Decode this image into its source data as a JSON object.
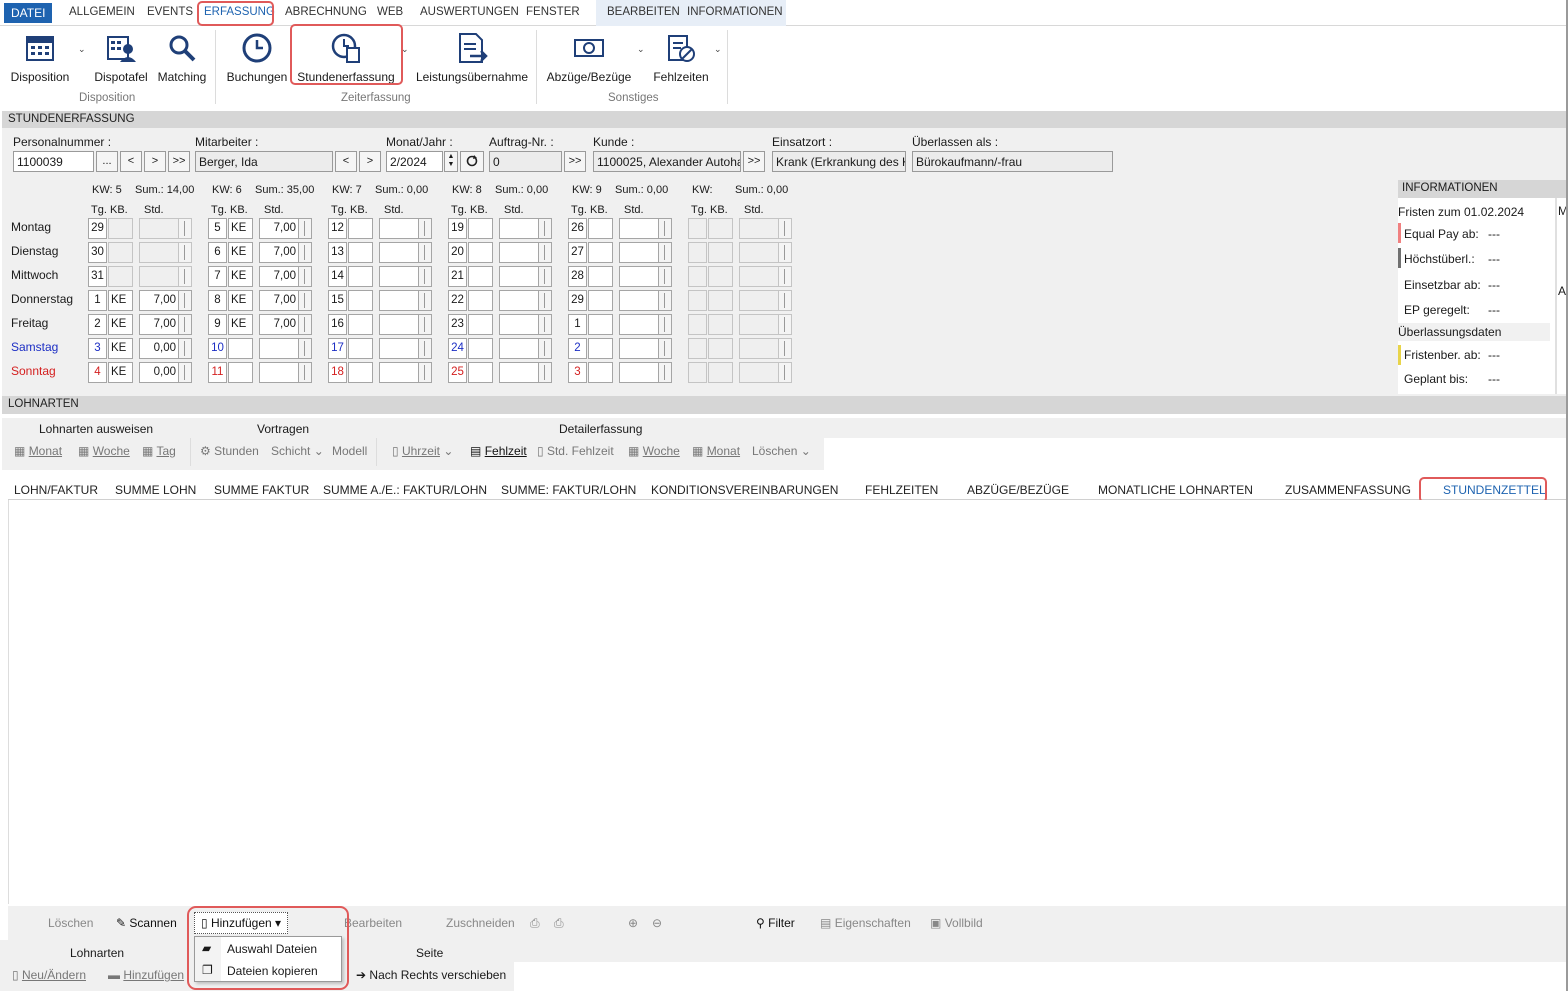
{
  "menu": {
    "file": "DATEI",
    "items": [
      "ALLGEMEIN",
      "EVENTS",
      "ERFASSUNG",
      "ABRECHNUNG",
      "WEB",
      "AUSWERTUNGEN",
      "FENSTER"
    ],
    "context": [
      "BEARBEITEN",
      "INFORMATIONEN"
    ]
  },
  "ribbon": {
    "buttons": [
      "Disposition",
      "Dispotafel",
      "Matching",
      "Buchungen",
      "Stundenerfassung",
      "Leistungsübernahme",
      "Abzüge/Bezüge",
      "Fehlzeiten"
    ],
    "groups": [
      "Disposition",
      "Zeiterfassung",
      "Sonstiges"
    ]
  },
  "stundenerfassung": {
    "section_title": "STUNDENERFASSUNG",
    "labels": {
      "personalnummer": "Personalnummer :",
      "mitarbeiter": "Mitarbeiter :",
      "monat_jahr": "Monat/Jahr :",
      "auftrag": "Auftrag-Nr. :",
      "kunde": "Kunde :",
      "einsatzort": "Einsatzort :",
      "ueberlassen": "Überlassen als :"
    },
    "values": {
      "personalnummer": "1100039",
      "mitarbeiter": "Berger, Ida",
      "monat_jahr": "2/2024",
      "auftrag": "0",
      "kunde": "1100025, Alexander Autoha",
      "einsatzort": "Krank (Erkrankung des K",
      "ueberlassen": "Bürokaufmann/-frau"
    },
    "nav": {
      "more": "...",
      "prev": "<",
      "next": ">",
      "last": ">>"
    },
    "days": [
      "Montag",
      "Dienstag",
      "Mittwoch",
      "Donnerstag",
      "Freitag",
      "Samstag",
      "Sonntag"
    ],
    "col_headers": {
      "tg": "Tg.",
      "kb": "KB.",
      "std": "Std."
    },
    "weeks": [
      {
        "kw": "KW: 5",
        "sum": "Sum.: 14,00",
        "rows": [
          [
            "29",
            "",
            ""
          ],
          [
            "30",
            "",
            ""
          ],
          [
            "31",
            "",
            ""
          ],
          [
            "1",
            "KE",
            "7,00"
          ],
          [
            "2",
            "KE",
            "7,00"
          ],
          [
            "3",
            "KE",
            "0,00"
          ],
          [
            "4",
            "KE",
            "0,00"
          ]
        ]
      },
      {
        "kw": "KW: 6",
        "sum": "Sum.: 35,00",
        "rows": [
          [
            "5",
            "KE",
            "7,00"
          ],
          [
            "6",
            "KE",
            "7,00"
          ],
          [
            "7",
            "KE",
            "7,00"
          ],
          [
            "8",
            "KE",
            "7,00"
          ],
          [
            "9",
            "KE",
            "7,00"
          ],
          [
            "10",
            "",
            ""
          ],
          [
            "11",
            "",
            ""
          ]
        ]
      },
      {
        "kw": "KW: 7",
        "sum": "Sum.: 0,00",
        "rows": [
          [
            "12",
            "",
            ""
          ],
          [
            "13",
            "",
            ""
          ],
          [
            "14",
            "",
            ""
          ],
          [
            "15",
            "",
            ""
          ],
          [
            "16",
            "",
            ""
          ],
          [
            "17",
            "",
            ""
          ],
          [
            "18",
            "",
            ""
          ]
        ]
      },
      {
        "kw": "KW: 8",
        "sum": "Sum.: 0,00",
        "rows": [
          [
            "19",
            "",
            ""
          ],
          [
            "20",
            "",
            ""
          ],
          [
            "21",
            "",
            ""
          ],
          [
            "22",
            "",
            ""
          ],
          [
            "23",
            "",
            ""
          ],
          [
            "24",
            "",
            ""
          ],
          [
            "25",
            "",
            ""
          ]
        ]
      },
      {
        "kw": "KW: 9",
        "sum": "Sum.: 0,00",
        "rows": [
          [
            "26",
            "",
            ""
          ],
          [
            "27",
            "",
            ""
          ],
          [
            "28",
            "",
            ""
          ],
          [
            "29",
            "",
            ""
          ],
          [
            "1",
            "",
            ""
          ],
          [
            "2",
            "",
            ""
          ],
          [
            "3",
            "",
            ""
          ]
        ]
      },
      {
        "kw": "KW:",
        "sum": "Sum.: 0,00",
        "rows": [
          [
            "",
            "",
            ""
          ],
          [
            "",
            "",
            ""
          ],
          [
            "",
            "",
            ""
          ],
          [
            "",
            "",
            ""
          ],
          [
            "",
            "",
            ""
          ],
          [
            "",
            "",
            ""
          ],
          [
            "",
            "",
            ""
          ]
        ]
      }
    ],
    "colors": {
      "saturday": "#1c2ec4",
      "sunday": "#d42020"
    }
  },
  "info": {
    "title": "INFORMATIONEN",
    "fristen": "Fristen zum 01.02.2024",
    "rows": [
      {
        "label": "Equal Pay ab:",
        "value": "---",
        "mark": "#f08080"
      },
      {
        "label": "Höchstüberl.:",
        "value": "---",
        "mark": "#707070"
      },
      {
        "label": "Einsetzbar ab:",
        "value": "---",
        "mark": ""
      },
      {
        "label": "EP geregelt:",
        "value": "---",
        "mark": ""
      }
    ],
    "ueberlassung_title": "Überlassungsdaten",
    "rows2": [
      {
        "label": "Fristenber. ab:",
        "value": "---",
        "mark": "#e8d44a"
      },
      {
        "label": "Geplant bis:",
        "value": "---",
        "mark": ""
      }
    ],
    "edge_letters": [
      "M",
      "A"
    ]
  },
  "lohnarten": {
    "section_title": "LOHNARTEN",
    "groups": [
      "Lohnarten ausweisen",
      "Vortragen",
      "Detailerfassung"
    ],
    "tools": [
      "Monat",
      "Woche",
      "Tag",
      "Stunden",
      "Schicht",
      "Modell",
      "Uhrzeit",
      "Fehlzeit",
      "Std. Fehlzeit",
      "Woche",
      "Monat",
      "Löschen"
    ]
  },
  "tabs": [
    "LOHN/FAKTUR",
    "SUMME LOHN",
    "SUMME FAKTUR",
    "SUMME A./E.: FAKTUR/LOHN",
    "SUMME: FAKTUR/LOHN",
    "KONDITIONSVEREINBARUNGEN",
    "FEHLZEITEN",
    "ABZÜGE/BEZÜGE",
    "MONATLICHE LOHNARTEN",
    "ZUSAMMENFASSUNG",
    "STUNDENZETTEL"
  ],
  "bottom_toolbar": [
    "Löschen",
    "Scannen",
    "Hinzufügen",
    "Bearbeiten",
    "Zuschneiden",
    "Filter",
    "Eigenschaften",
    "Vollbild"
  ],
  "dropdown": [
    "Auswahl Dateien",
    "Dateien kopieren"
  ],
  "bottom2": {
    "groups": [
      "Lohnarten",
      "Seite"
    ],
    "items": [
      "Neu/Ändern",
      "Hinzufügen",
      "Nach Rechts verschieben"
    ]
  }
}
